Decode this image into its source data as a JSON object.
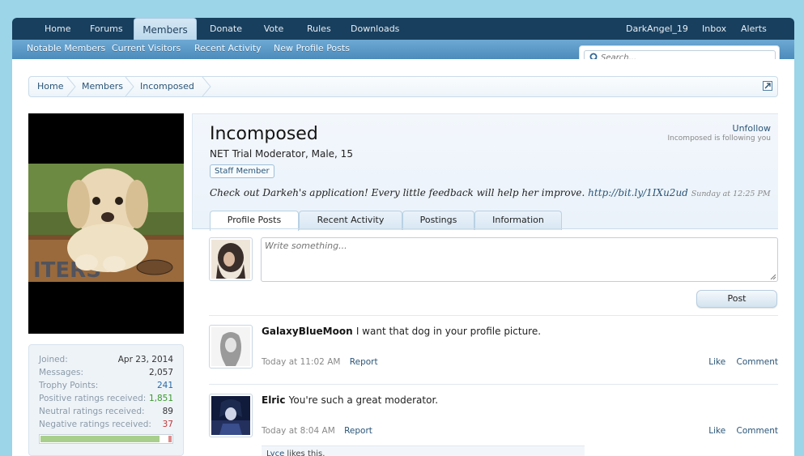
{
  "nav": {
    "tabs": [
      {
        "label": "Home"
      },
      {
        "label": "Forums"
      },
      {
        "label": "Members",
        "active": true
      },
      {
        "label": "Donate"
      },
      {
        "label": "Vote"
      },
      {
        "label": "Rules"
      },
      {
        "label": "Downloads"
      }
    ],
    "right": {
      "user": "DarkAngel_19",
      "inbox": "Inbox",
      "alerts": "Alerts"
    },
    "sub": [
      "Notable Members",
      "Current Visitors",
      "Recent Activity",
      "New Profile Posts"
    ],
    "search_placeholder": "Search..."
  },
  "breadcrumb": [
    "Home",
    "Members",
    "Incomposed"
  ],
  "stats": [
    {
      "label": "Joined:",
      "value": "Apr 23, 2014",
      "tone": ""
    },
    {
      "label": "Messages:",
      "value": "2,057",
      "tone": ""
    },
    {
      "label": "Trophy Points:",
      "value": "241",
      "tone": "blue"
    },
    {
      "label": "Positive ratings received:",
      "value": "1,851",
      "tone": "green"
    },
    {
      "label": "Neutral ratings received:",
      "value": "89",
      "tone": ""
    },
    {
      "label": "Negative ratings received:",
      "value": "37",
      "tone": "red"
    }
  ],
  "rating_positive_fraction": 0.93,
  "profile": {
    "username": "Incomposed",
    "user_title": "NET Trial Moderator, Male, 15",
    "badge": "Staff Member",
    "follow": "Unfollow",
    "follow_note": "Incomposed is following you",
    "status_text": "Check out Darkeh's application! Every little feedback will help her improve.",
    "status_link": "http://bit.ly/1IXu2ud",
    "status_time": "Sunday at 12:25 PM",
    "tabs": [
      "Profile Posts",
      "Recent Activity",
      "Postings",
      "Information"
    ]
  },
  "composer": {
    "placeholder": "Write something...",
    "post_label": "Post"
  },
  "messages": [
    {
      "author": "GalaxyBlueMoon",
      "text": "I want that dog in your profile picture.",
      "time": "Today at 11:02 AM",
      "report": "Report",
      "like": "Like",
      "comment": "Comment"
    },
    {
      "author": "Elric",
      "text": "You're such a great moderator.",
      "time": "Today at 8:04 AM",
      "report": "Report",
      "like": "Like",
      "comment": "Comment"
    }
  ],
  "likes": {
    "who": "Lyce",
    "text": " likes this."
  },
  "colors": {
    "nav_bg": "#183f5e",
    "subnav_bg": "#5a97c7",
    "link": "#2a5577",
    "page_bg": "#9cd4e8"
  }
}
